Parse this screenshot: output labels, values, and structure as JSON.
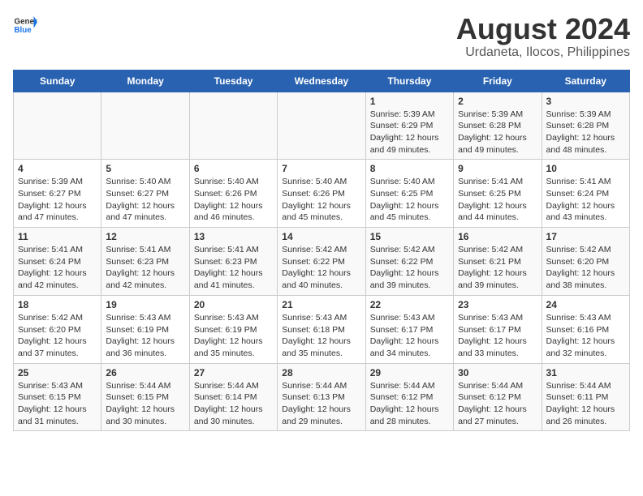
{
  "header": {
    "logo_general": "General",
    "logo_blue": "Blue",
    "title": "August 2024",
    "subtitle": "Urdaneta, Ilocos, Philippines"
  },
  "calendar": {
    "days_of_week": [
      "Sunday",
      "Monday",
      "Tuesday",
      "Wednesday",
      "Thursday",
      "Friday",
      "Saturday"
    ],
    "weeks": [
      [
        {
          "day": "",
          "info": ""
        },
        {
          "day": "",
          "info": ""
        },
        {
          "day": "",
          "info": ""
        },
        {
          "day": "",
          "info": ""
        },
        {
          "day": "1",
          "info": "Sunrise: 5:39 AM\nSunset: 6:29 PM\nDaylight: 12 hours\nand 49 minutes."
        },
        {
          "day": "2",
          "info": "Sunrise: 5:39 AM\nSunset: 6:28 PM\nDaylight: 12 hours\nand 49 minutes."
        },
        {
          "day": "3",
          "info": "Sunrise: 5:39 AM\nSunset: 6:28 PM\nDaylight: 12 hours\nand 48 minutes."
        }
      ],
      [
        {
          "day": "4",
          "info": "Sunrise: 5:39 AM\nSunset: 6:27 PM\nDaylight: 12 hours\nand 47 minutes."
        },
        {
          "day": "5",
          "info": "Sunrise: 5:40 AM\nSunset: 6:27 PM\nDaylight: 12 hours\nand 47 minutes."
        },
        {
          "day": "6",
          "info": "Sunrise: 5:40 AM\nSunset: 6:26 PM\nDaylight: 12 hours\nand 46 minutes."
        },
        {
          "day": "7",
          "info": "Sunrise: 5:40 AM\nSunset: 6:26 PM\nDaylight: 12 hours\nand 45 minutes."
        },
        {
          "day": "8",
          "info": "Sunrise: 5:40 AM\nSunset: 6:25 PM\nDaylight: 12 hours\nand 45 minutes."
        },
        {
          "day": "9",
          "info": "Sunrise: 5:41 AM\nSunset: 6:25 PM\nDaylight: 12 hours\nand 44 minutes."
        },
        {
          "day": "10",
          "info": "Sunrise: 5:41 AM\nSunset: 6:24 PM\nDaylight: 12 hours\nand 43 minutes."
        }
      ],
      [
        {
          "day": "11",
          "info": "Sunrise: 5:41 AM\nSunset: 6:24 PM\nDaylight: 12 hours\nand 42 minutes."
        },
        {
          "day": "12",
          "info": "Sunrise: 5:41 AM\nSunset: 6:23 PM\nDaylight: 12 hours\nand 42 minutes."
        },
        {
          "day": "13",
          "info": "Sunrise: 5:41 AM\nSunset: 6:23 PM\nDaylight: 12 hours\nand 41 minutes."
        },
        {
          "day": "14",
          "info": "Sunrise: 5:42 AM\nSunset: 6:22 PM\nDaylight: 12 hours\nand 40 minutes."
        },
        {
          "day": "15",
          "info": "Sunrise: 5:42 AM\nSunset: 6:22 PM\nDaylight: 12 hours\nand 39 minutes."
        },
        {
          "day": "16",
          "info": "Sunrise: 5:42 AM\nSunset: 6:21 PM\nDaylight: 12 hours\nand 39 minutes."
        },
        {
          "day": "17",
          "info": "Sunrise: 5:42 AM\nSunset: 6:20 PM\nDaylight: 12 hours\nand 38 minutes."
        }
      ],
      [
        {
          "day": "18",
          "info": "Sunrise: 5:42 AM\nSunset: 6:20 PM\nDaylight: 12 hours\nand 37 minutes."
        },
        {
          "day": "19",
          "info": "Sunrise: 5:43 AM\nSunset: 6:19 PM\nDaylight: 12 hours\nand 36 minutes."
        },
        {
          "day": "20",
          "info": "Sunrise: 5:43 AM\nSunset: 6:19 PM\nDaylight: 12 hours\nand 35 minutes."
        },
        {
          "day": "21",
          "info": "Sunrise: 5:43 AM\nSunset: 6:18 PM\nDaylight: 12 hours\nand 35 minutes."
        },
        {
          "day": "22",
          "info": "Sunrise: 5:43 AM\nSunset: 6:17 PM\nDaylight: 12 hours\nand 34 minutes."
        },
        {
          "day": "23",
          "info": "Sunrise: 5:43 AM\nSunset: 6:17 PM\nDaylight: 12 hours\nand 33 minutes."
        },
        {
          "day": "24",
          "info": "Sunrise: 5:43 AM\nSunset: 6:16 PM\nDaylight: 12 hours\nand 32 minutes."
        }
      ],
      [
        {
          "day": "25",
          "info": "Sunrise: 5:43 AM\nSunset: 6:15 PM\nDaylight: 12 hours\nand 31 minutes."
        },
        {
          "day": "26",
          "info": "Sunrise: 5:44 AM\nSunset: 6:15 PM\nDaylight: 12 hours\nand 30 minutes."
        },
        {
          "day": "27",
          "info": "Sunrise: 5:44 AM\nSunset: 6:14 PM\nDaylight: 12 hours\nand 30 minutes."
        },
        {
          "day": "28",
          "info": "Sunrise: 5:44 AM\nSunset: 6:13 PM\nDaylight: 12 hours\nand 29 minutes."
        },
        {
          "day": "29",
          "info": "Sunrise: 5:44 AM\nSunset: 6:12 PM\nDaylight: 12 hours\nand 28 minutes."
        },
        {
          "day": "30",
          "info": "Sunrise: 5:44 AM\nSunset: 6:12 PM\nDaylight: 12 hours\nand 27 minutes."
        },
        {
          "day": "31",
          "info": "Sunrise: 5:44 AM\nSunset: 6:11 PM\nDaylight: 12 hours\nand 26 minutes."
        }
      ]
    ]
  }
}
